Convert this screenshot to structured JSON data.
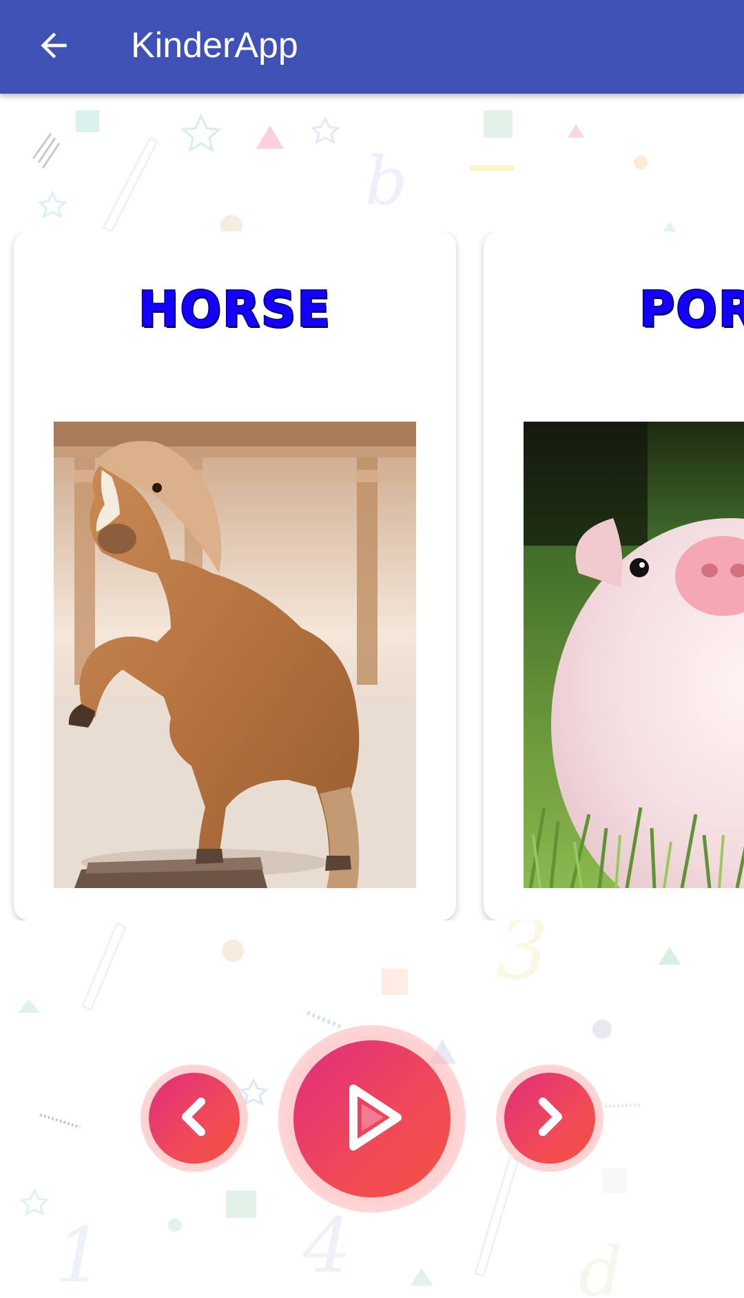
{
  "app_bar": {
    "title": "KinderApp",
    "background_color": "#3f51b5",
    "back_icon": "arrow-left-icon"
  },
  "cards": [
    {
      "title": "HORSE",
      "image": "pony-photo",
      "image_description_icon": "horse-photo"
    },
    {
      "title": "PORC",
      "image": "piglet-photo",
      "image_description_icon": "pig-photo"
    }
  ],
  "controls": {
    "previous_icon": "chevron-left-icon",
    "play_icon": "play-icon",
    "next_icon": "chevron-right-icon",
    "accent_start": "#e02d7e",
    "accent_end": "#f5503f"
  },
  "colors": {
    "card_title": "#1500ff",
    "card_background": "#ffffff"
  }
}
